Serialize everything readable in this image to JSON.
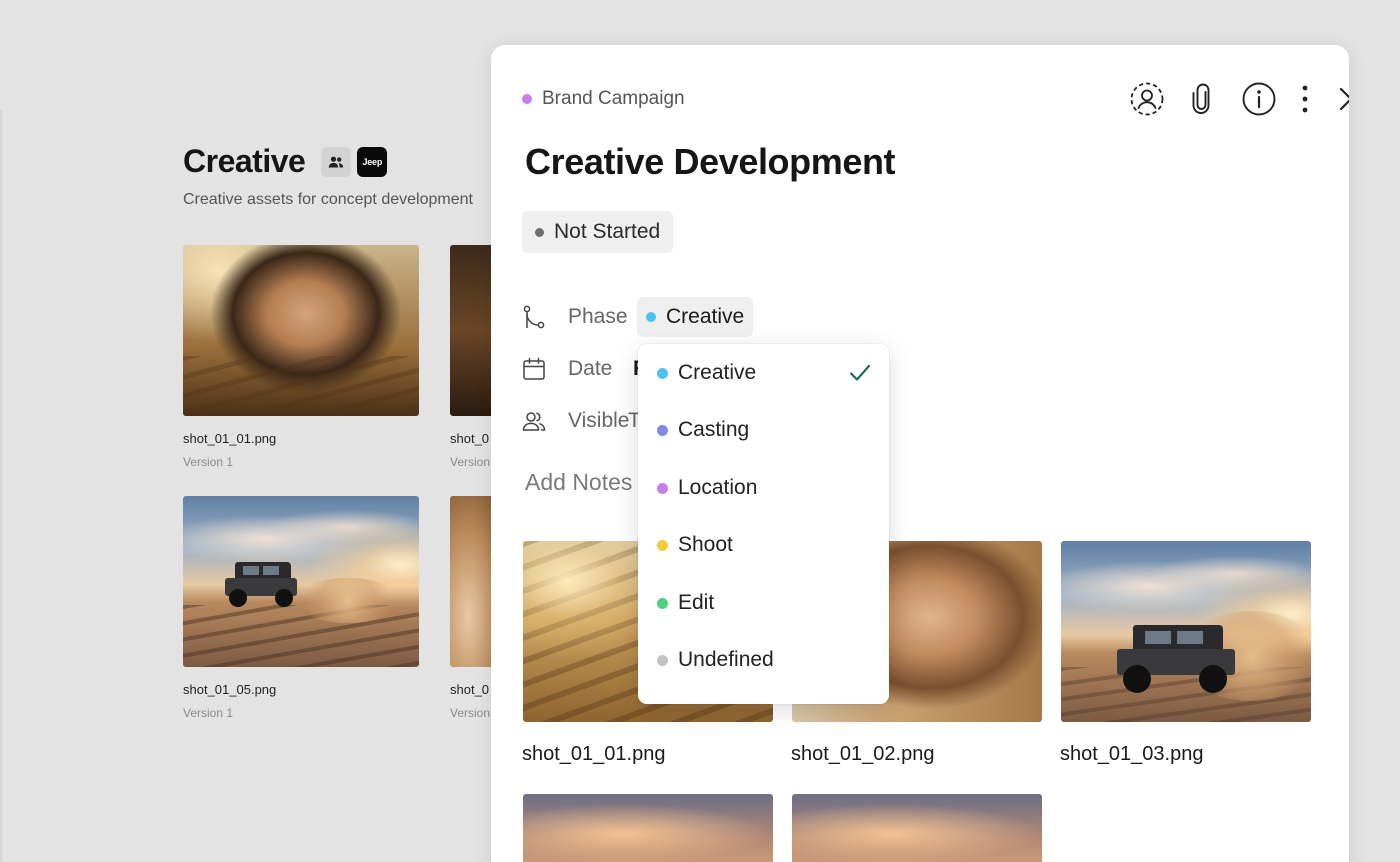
{
  "background": {
    "title": "Creative",
    "badge_brand": "Jeep",
    "subtitle": "Creative assets for concept development",
    "assets": [
      {
        "name": "shot_01_01.png",
        "version": "Version 1"
      },
      {
        "name": "shot_0",
        "version": "Version"
      },
      {
        "name": "shot_01_05.png",
        "version": "Version 1"
      },
      {
        "name": "shot_0",
        "version": "Version"
      }
    ]
  },
  "panel": {
    "breadcrumb": "Brand Campaign",
    "breadcrumb_color": "#c77ee6",
    "title": "Creative Development",
    "status": {
      "label": "Not Started",
      "color": "#6f6f6f"
    },
    "properties": {
      "phase_label": "Phase",
      "phase_value": "Creative",
      "phase_color": "#4cc3ef",
      "date_label": "Date",
      "date_peek": "F",
      "visible_label": "Visible",
      "visible_peek": "T"
    },
    "add_notes": "Add Notes",
    "assets": [
      {
        "name": "shot_01_01.png"
      },
      {
        "name": "shot_01_02.png"
      },
      {
        "name": "shot_01_03.png"
      }
    ],
    "toolbar_icons": [
      "assignee-icon",
      "paperclip-icon",
      "info-icon",
      "more-vertical-icon",
      "close-icon"
    ]
  },
  "phase_dropdown": {
    "selected": "Creative",
    "options": [
      {
        "label": "Creative",
        "color": "#4cc3ef"
      },
      {
        "label": "Casting",
        "color": "#7f8be0"
      },
      {
        "label": "Location",
        "color": "#c77ee6"
      },
      {
        "label": "Shoot",
        "color": "#f2cb3e"
      },
      {
        "label": "Edit",
        "color": "#4fd07f"
      },
      {
        "label": "Undefined",
        "color": "#c2c2c2"
      }
    ]
  }
}
